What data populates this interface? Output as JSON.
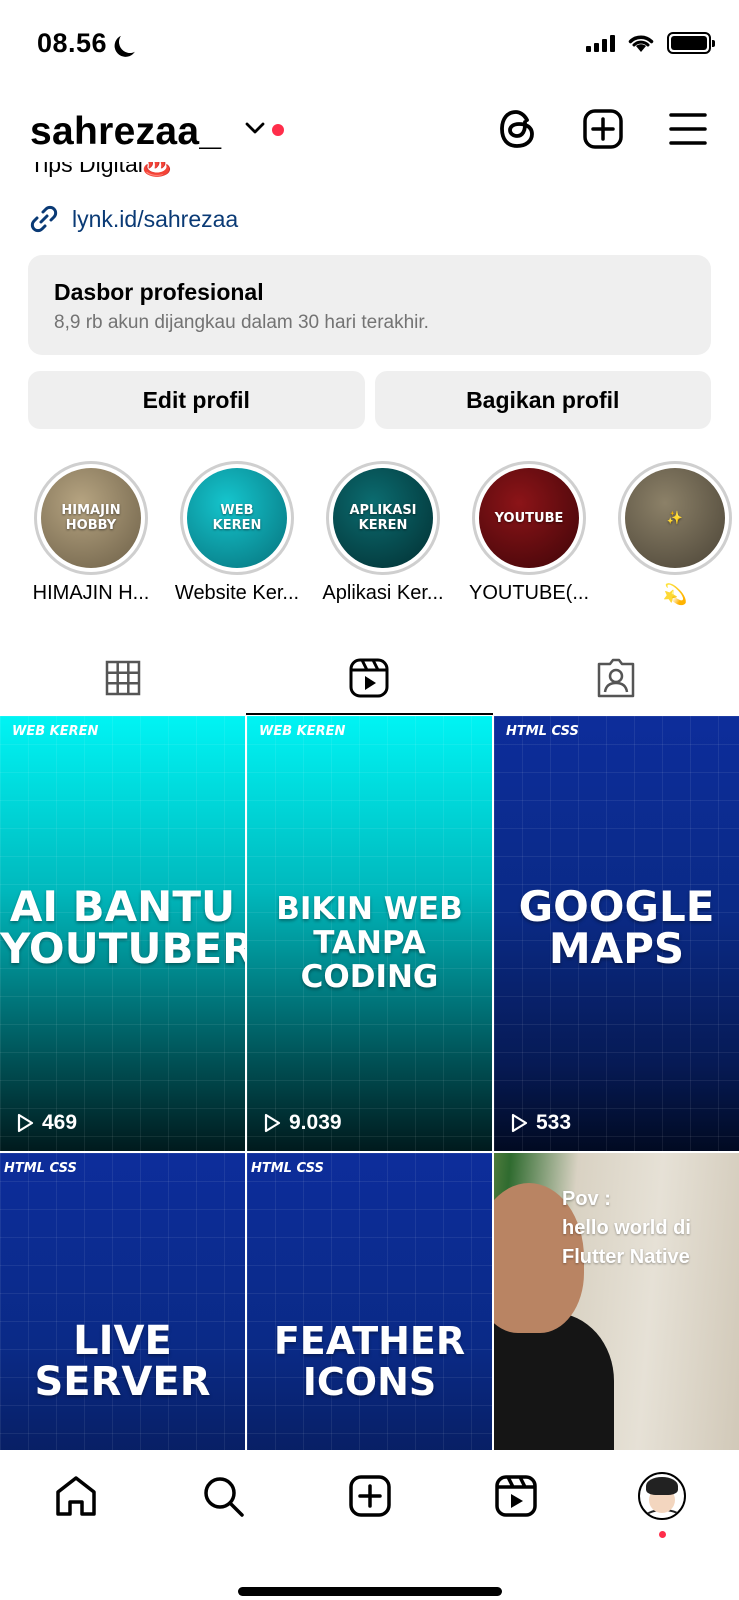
{
  "status_bar": {
    "time": "08.56"
  },
  "header": {
    "username": "sahrezaa_"
  },
  "bio": {
    "text": "Tips Digital♨️",
    "link": "lynk.id/sahrezaa"
  },
  "dashboard": {
    "title": "Dasbor profesional",
    "subtitle": "8,9 rb akun dijangkau dalam 30 hari terakhir."
  },
  "buttons": {
    "edit": "Edit profil",
    "share": "Bagikan profil"
  },
  "highlights": [
    {
      "cover_text": "HIMAJIN\nHOBBY",
      "label": "HIMAJIN H...",
      "color": "#8a7a5e"
    },
    {
      "cover_text": "WEB\nKEREN",
      "label": "Website Ker...",
      "color": "#0b9aa5"
    },
    {
      "cover_text": "APLIKASI\nKEREN",
      "label": "Aplikasi Ker...",
      "color": "#064b4f"
    },
    {
      "cover_text": "YOUTUBE",
      "label": "YOUTUBE(...",
      "color": "#6b0c0f"
    },
    {
      "cover_text": "✨",
      "label": "💫",
      "color": "#6f6655"
    }
  ],
  "tabs": [
    {
      "icon": "grid-icon",
      "active": false
    },
    {
      "icon": "reels-icon",
      "active": true
    },
    {
      "icon": "tagged-icon",
      "active": false
    }
  ],
  "reels": [
    {
      "tag": "WEB KEREN",
      "title": "AI BANTU\nYOUTUBER",
      "views": "469",
      "style": "cyan"
    },
    {
      "tag": "WEB KEREN",
      "title": "BIKIN WEB\nTANPA CODING",
      "views": "9.039",
      "style": "cyan"
    },
    {
      "tag": "HTML CSS",
      "title": "GOOGLE\nMAPS",
      "views": "533",
      "style": "blue"
    },
    {
      "tag": "HTML CSS",
      "title": "LIVE\nSERVER",
      "views": "",
      "style": "blue"
    },
    {
      "tag": "HTML CSS",
      "title": "FEATHER\nICONS",
      "views": "",
      "style": "blue"
    },
    {
      "tag": "",
      "title": "Pov :\nhello world di\nFlutter Native",
      "views": "",
      "style": "photo"
    }
  ],
  "colors": {
    "accent_red": "#ff2d4a",
    "link_blue": "#0a3a75",
    "button_grey": "#efefef"
  }
}
